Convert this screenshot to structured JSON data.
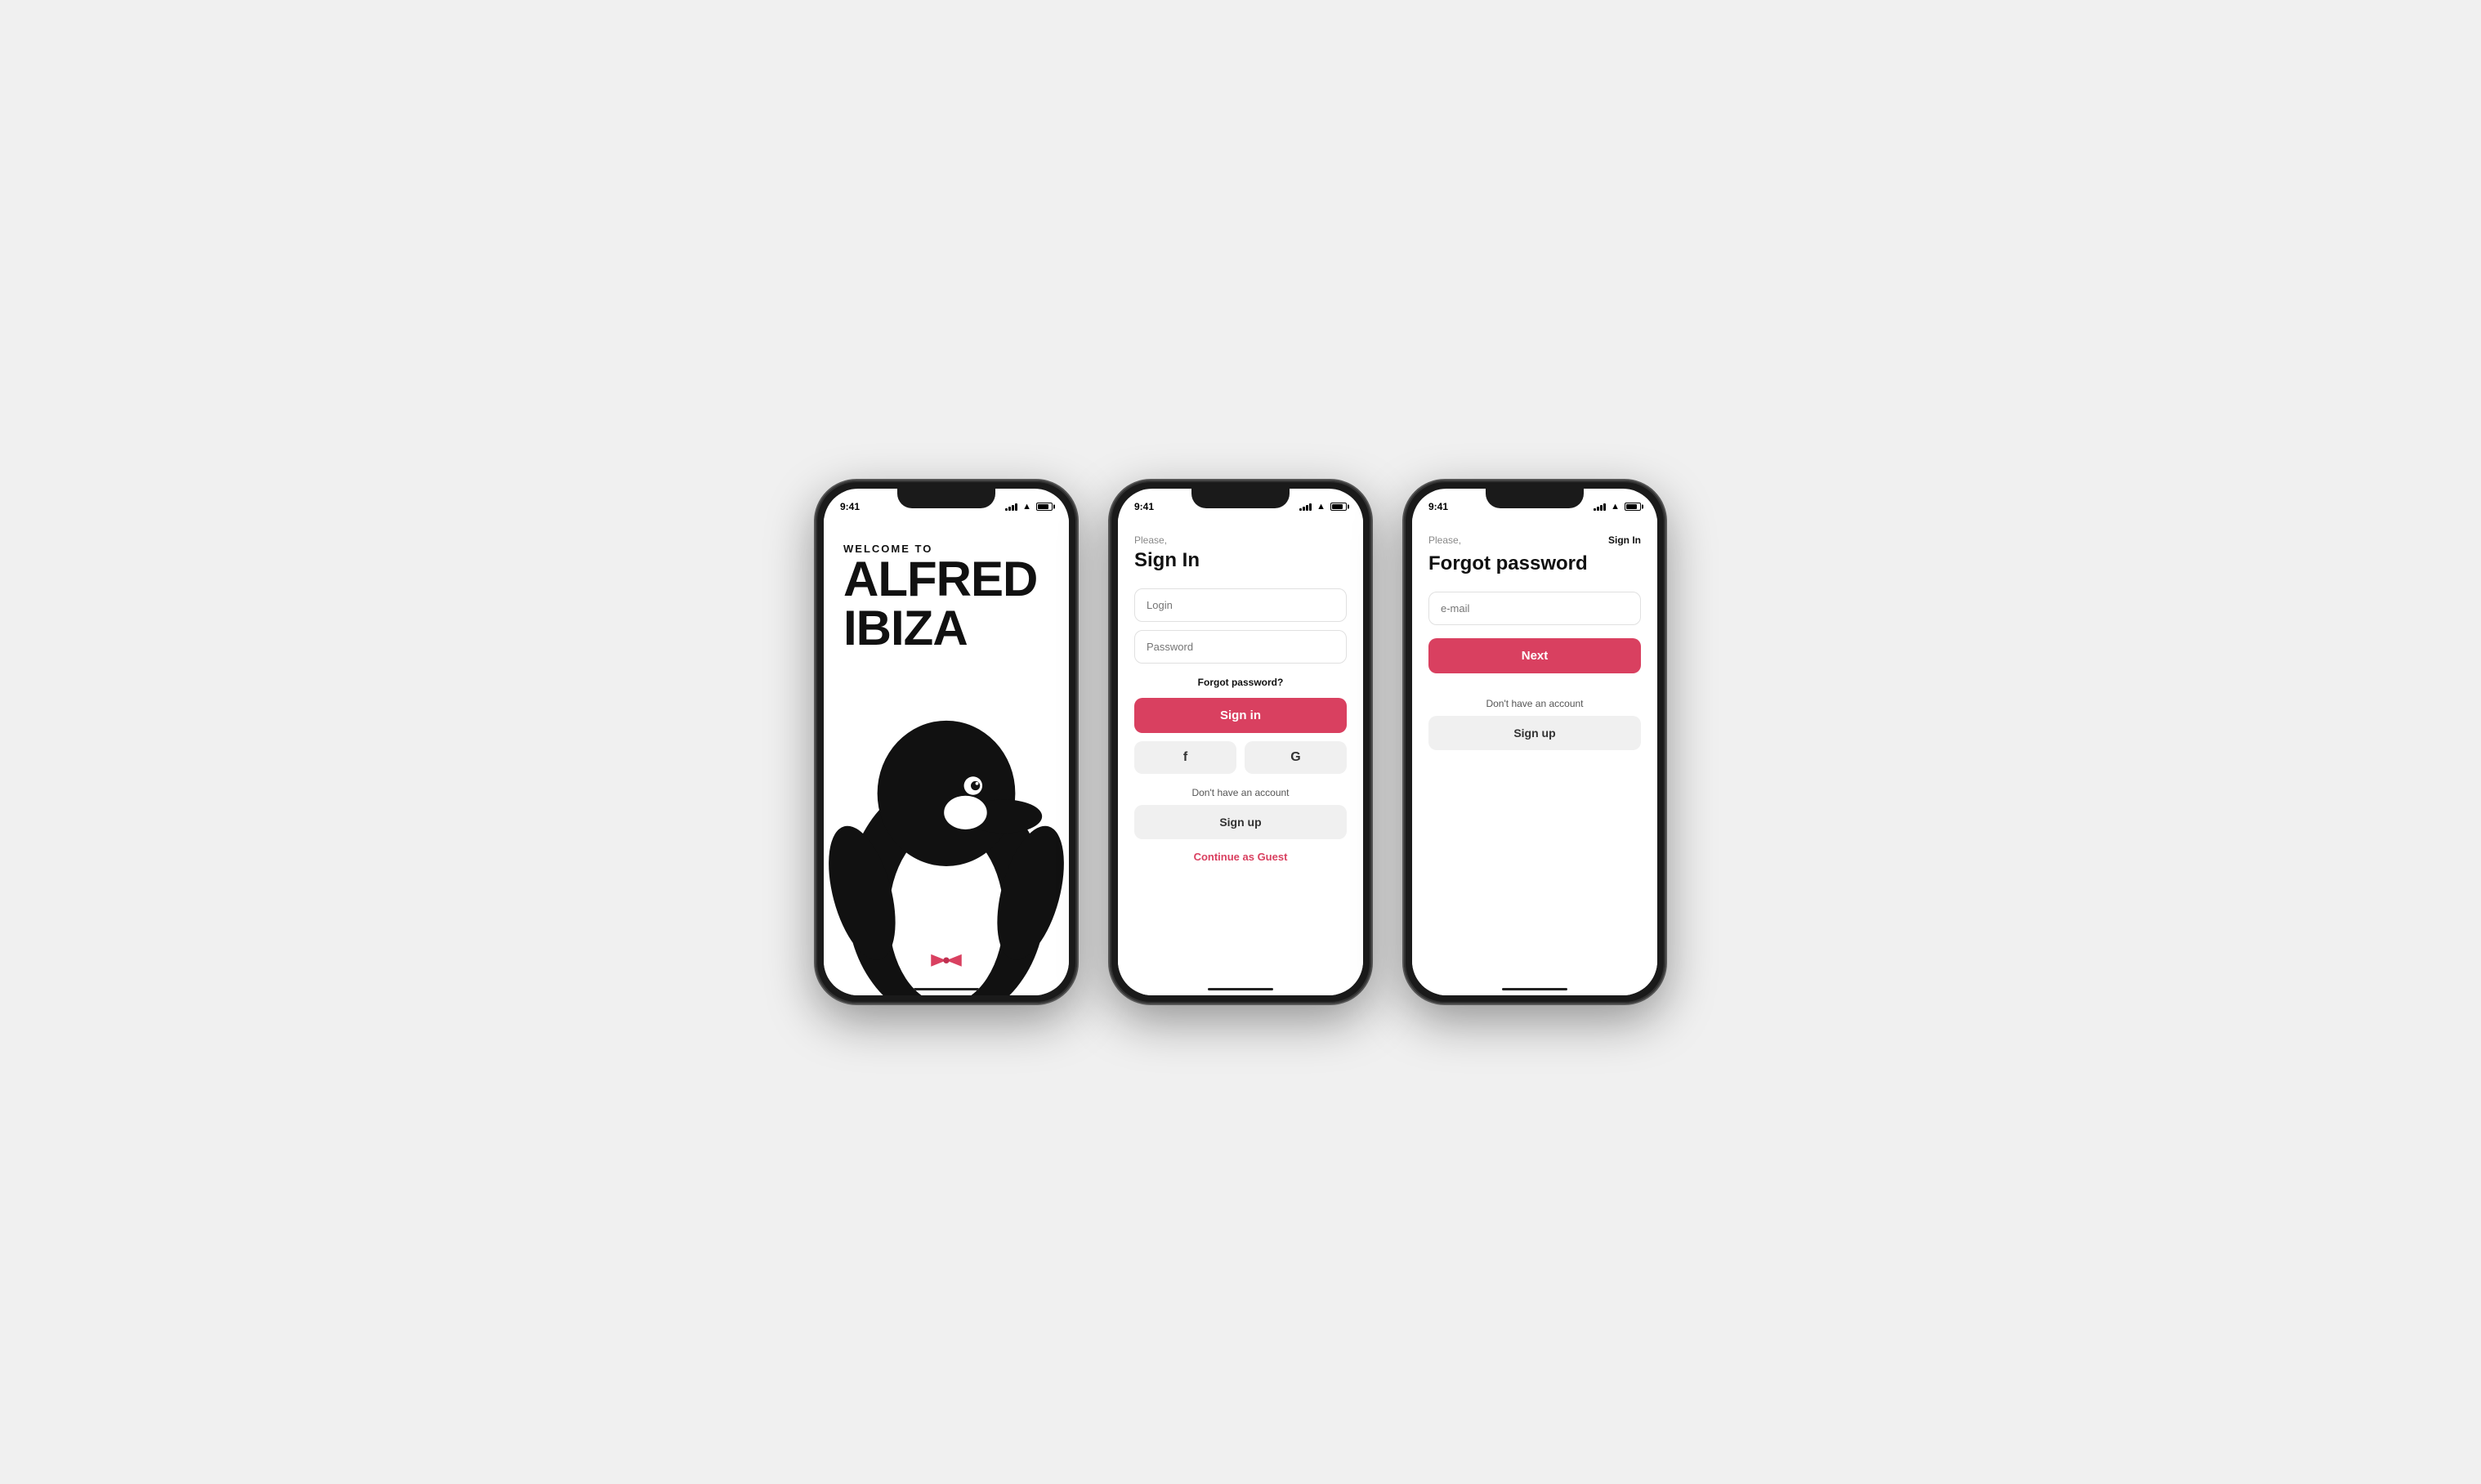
{
  "colors": {
    "primary": "#d94060",
    "dark": "#111111",
    "gray": "#f0f0f0",
    "lightGray": "#e0e0e0",
    "textGray": "#888888",
    "white": "#ffffff"
  },
  "screen1": {
    "status_time": "9:41",
    "welcome_line": "WELCOME TO",
    "app_name_1": "ALFRED",
    "app_name_2": "IBIZA"
  },
  "screen2": {
    "status_time": "9:41",
    "subtitle": "Please,",
    "title": "Sign In",
    "login_placeholder": "Login",
    "password_placeholder": "Password",
    "forgot_label": "Forgot password?",
    "signin_btn": "Sign in",
    "facebook_icon": "f",
    "google_icon": "G",
    "no_account_text": "Don't have an account",
    "signup_btn": "Sign up",
    "guest_link": "Continue as Guest"
  },
  "screen3": {
    "status_time": "9:41",
    "subtitle": "Please,",
    "signin_link": "Sign In",
    "title": "Forgot password",
    "email_placeholder": "e-mail",
    "next_btn": "Next",
    "no_account_text": "Don't have an account",
    "signup_btn": "Sign up"
  }
}
